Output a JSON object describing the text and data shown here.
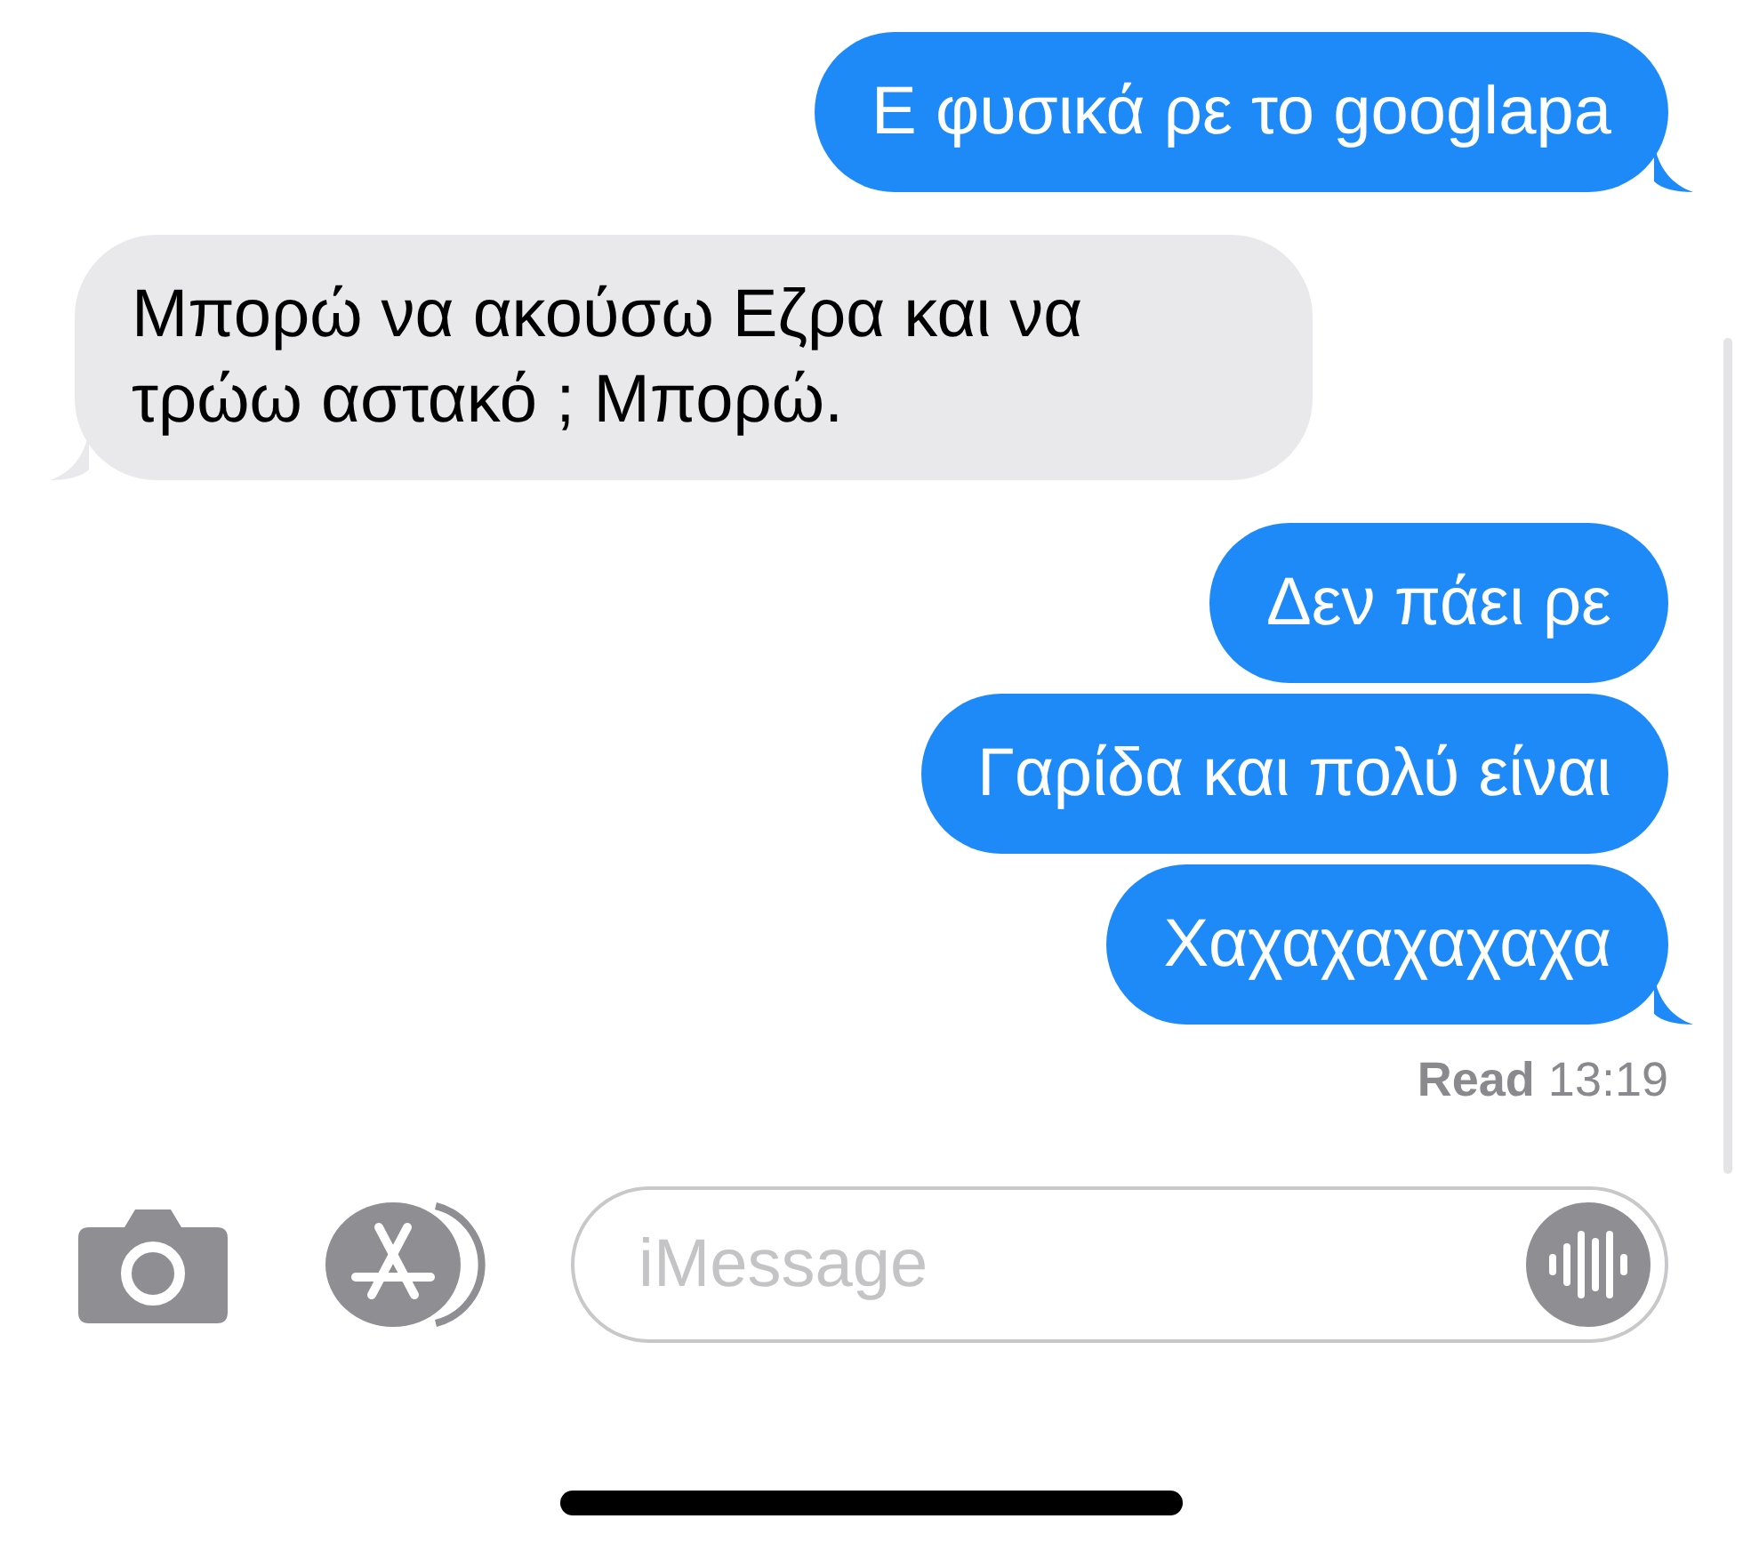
{
  "messages": [
    {
      "text": "Ε φυσικά ρε το googlapa",
      "kind": "sent",
      "tail": true
    },
    {
      "text": "Μπορώ να ακούσω Εζρα και να τρώω αστακό ; Μπορώ.",
      "kind": "received",
      "tail": true
    },
    {
      "text": "Δεν πάει ρε",
      "kind": "sent",
      "tail": false
    },
    {
      "text": "Γαρίδα και πολύ είναι",
      "kind": "sent",
      "tail": false
    },
    {
      "text": "Χαχαχαχαχαχα",
      "kind": "sent",
      "tail": true
    }
  ],
  "receipt": "**Read** 13:19",
  "composer": {
    "placeholder": "iMessage"
  }
}
